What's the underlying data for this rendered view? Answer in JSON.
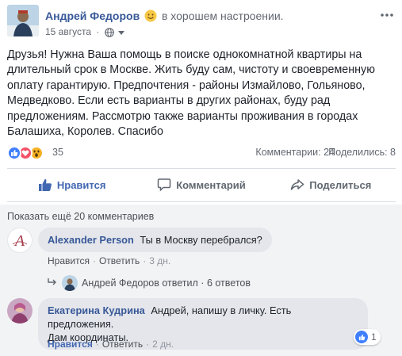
{
  "post": {
    "author": "Андрей Федоров",
    "feeling": "в хорошем настроении.",
    "date": "15 августа",
    "separator": "·",
    "text": "Друзья! Нужна Ваша помощь в поиске однокомнатной квартиры на длительный срок в Москве. Жить буду сам, чистоту и своевременную оплату гарантирую. Предпочтения - районы Измайлово, Гольяново, Медведково. Если есть варианты в других районах, буду рад предложениям. Рассмотрю также варианты проживания в городах Балашиха, Королев. Спасибо"
  },
  "reactions": {
    "icons": [
      "like-icon",
      "love-icon",
      "wow-icon"
    ],
    "count": "35",
    "comments_label": "Комментарии: 24",
    "shares_label": "Поделились: 8"
  },
  "actions": {
    "like": "Нравится",
    "comment": "Комментарий",
    "share": "Поделиться"
  },
  "comments": {
    "show_more": "Показать ещё 20 комментариев",
    "items": [
      {
        "name": "Alexander Person",
        "text": "Ты в Москву перебрался?",
        "like": "Нравится",
        "reply": "Ответить",
        "time": "3 дн."
      },
      {
        "name": "Екатерина Кудрина",
        "text_line1": "Андрей, напишу в личку. Есть предложения.",
        "text_line2": "Дам координаты.",
        "like": "Нравится",
        "reply": "Ответить",
        "time": "2 дн.",
        "likes": "1"
      }
    ],
    "reply_summary": {
      "name": "Андрей Федоров",
      "action": "ответил",
      "sep": "·",
      "count": "6 ответов"
    }
  },
  "colors": {
    "link": "#385898",
    "like_blue": "#4267b2",
    "love_red": "#f25268",
    "wow_yellow": "#f7b125"
  }
}
